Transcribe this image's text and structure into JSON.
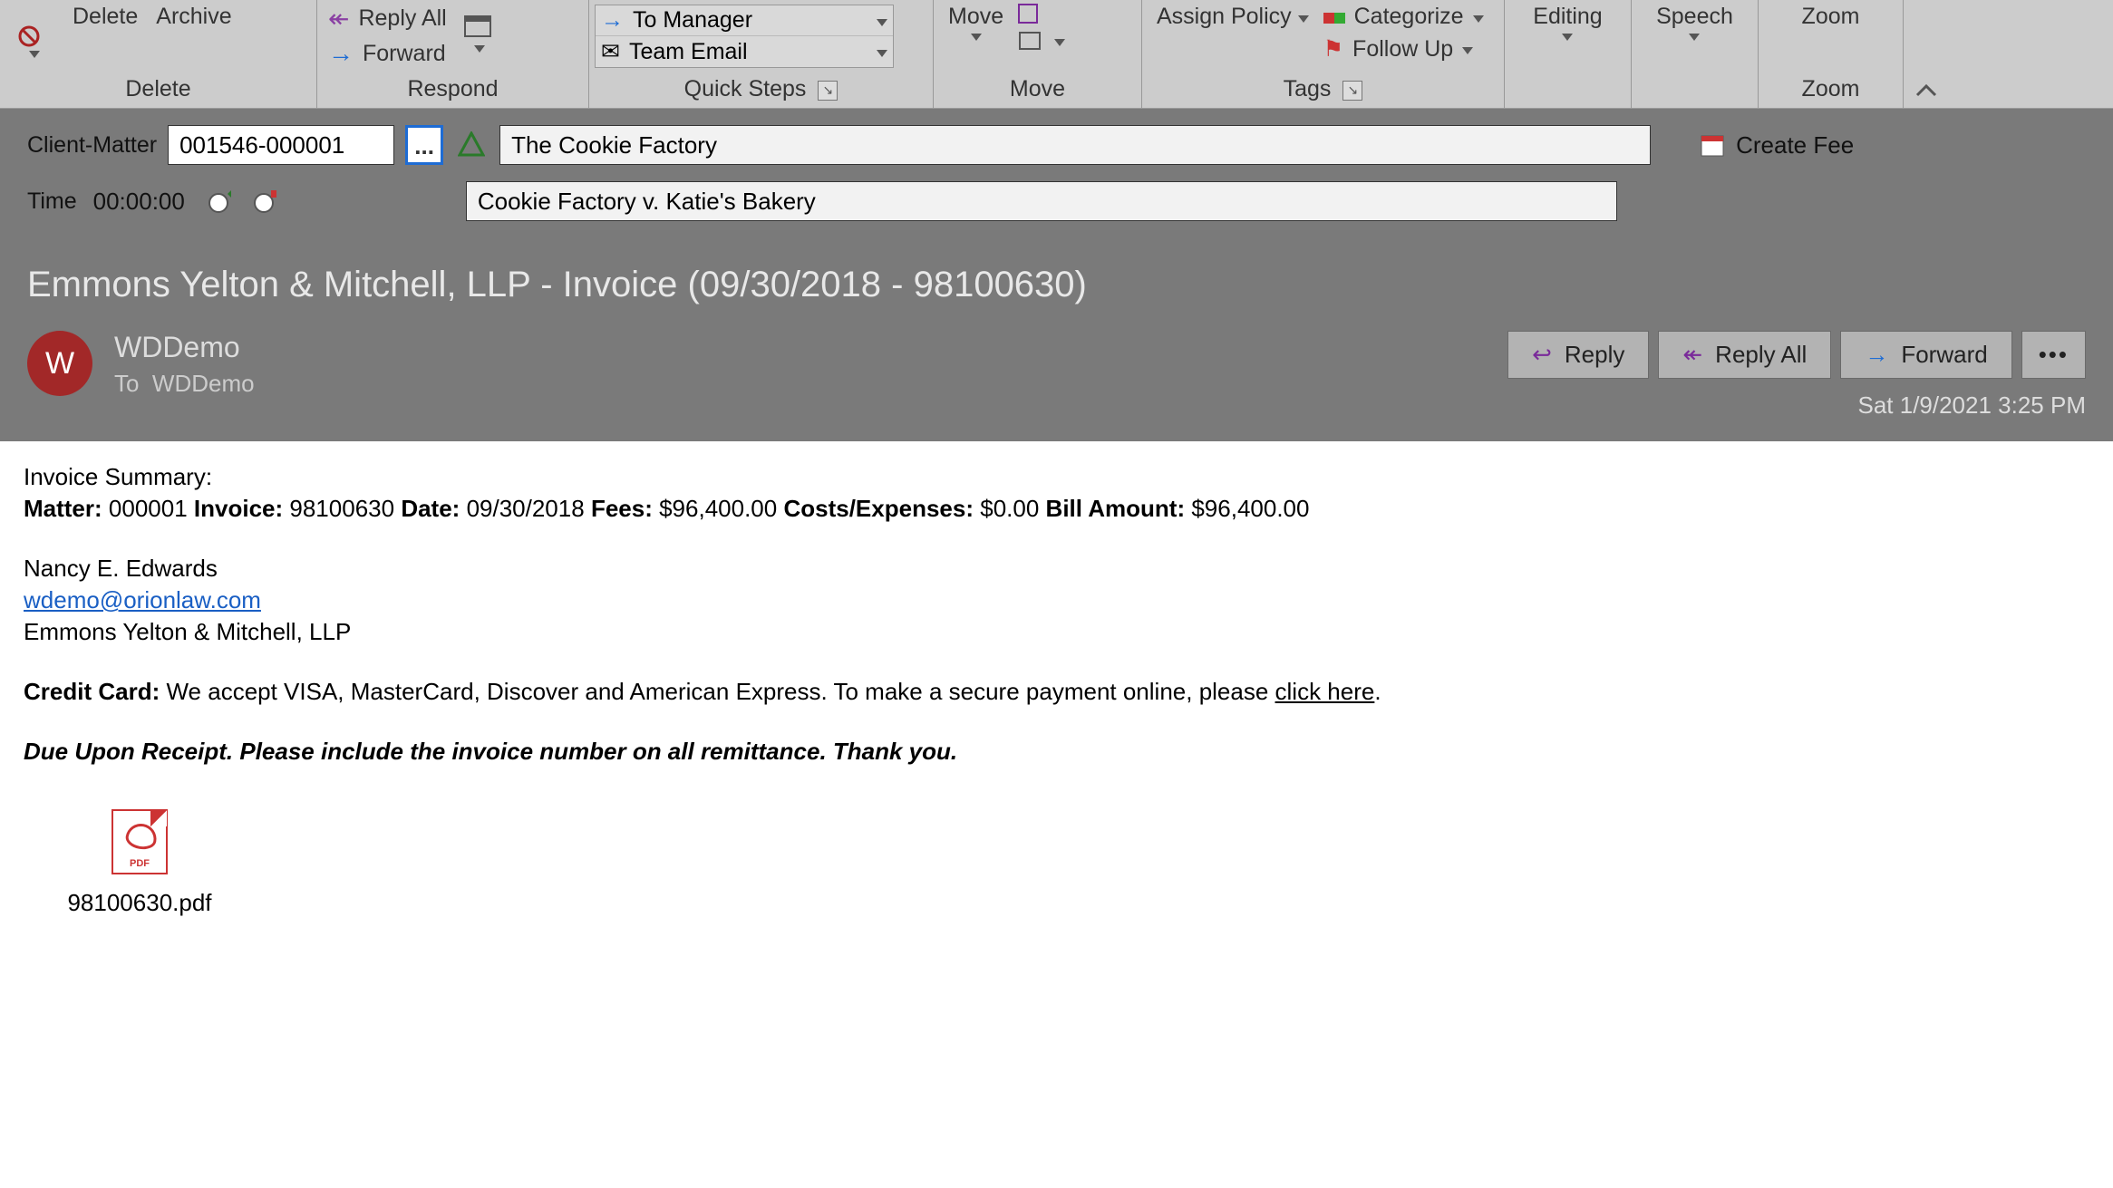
{
  "ribbon": {
    "delete_group": "Delete",
    "respond_group": "Respond",
    "quicksteps_group": "Quick Steps",
    "move_group": "Move",
    "tags_group": "Tags",
    "zoom_group": "Zoom",
    "delete_btn": "Delete",
    "archive_btn": "Archive",
    "reply_all": "Reply All",
    "forward": "Forward",
    "to_manager": "To Manager",
    "team_email": "Team Email",
    "move_btn": "Move",
    "assign_policy": "Assign Policy",
    "categorize": "Categorize",
    "follow_up": "Follow Up",
    "editing": "Editing",
    "speech": "Speech",
    "zoom": "Zoom"
  },
  "client_matter": {
    "label": "Client-Matter",
    "value": "001546-000001",
    "name_field": "The Cookie Factory",
    "matter_desc": "Cookie Factory v. Katie's Bakery",
    "create_fee": "Create Fee"
  },
  "time": {
    "label": "Time",
    "value": "00:00:00"
  },
  "email": {
    "subject": "Emmons Yelton & Mitchell, LLP - Invoice (09/30/2018 -  98100630)",
    "avatar_initial": "W",
    "from": "WDDemo",
    "to_label": "To",
    "to": "WDDemo",
    "reply": "Reply",
    "reply_all": "Reply All",
    "forward": "Forward",
    "date": "Sat 1/9/2021 3:25 PM"
  },
  "body": {
    "invoice_summary_label": "Invoice Summary:",
    "matter_label": "Matter:",
    "matter_val": "000001",
    "invoice_label": "Invoice:",
    "invoice_val": "98100630",
    "date_label": "Date:",
    "date_val": "09/30/2018",
    "fees_label": "Fees:",
    "fees_val": "$96,400.00",
    "costs_label": "Costs/Expenses:",
    "costs_val": "$0.00",
    "bill_label": "Bill Amount:",
    "bill_val": "$96,400.00",
    "sig_name": "Nancy E. Edwards",
    "sig_email": "wdemo@orionlaw.com",
    "sig_firm": "Emmons Yelton & Mitchell, LLP",
    "cc_label": "Credit Card:",
    "cc_text_pre": " We accept VISA, MasterCard, Discover and American Express.  To make a secure payment online, please ",
    "cc_link": "click here",
    "cc_text_post": ".",
    "due_text": "Due Upon Receipt.  Please include the invoice number on all remittance.  Thank you."
  },
  "attachment": {
    "filename": "98100630.pdf"
  }
}
